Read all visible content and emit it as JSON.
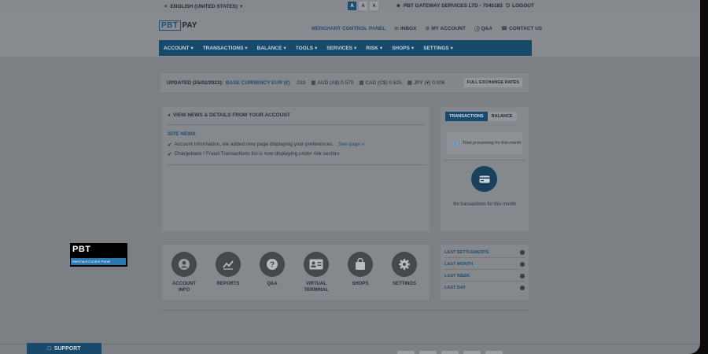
{
  "topbar": {
    "language": "ENGLISH (UNITED STATES)",
    "font_sizes": [
      "A",
      "A",
      "A"
    ],
    "company": "PBT GATEWAY SERVICES LTD - 7045183",
    "logout": "LOGOUT"
  },
  "logo": {
    "box_text": "PBT",
    "suffix": "PAY"
  },
  "header_links": {
    "merchant_panel": "MERCHANT CONTROL PANEL",
    "inbox": "INBOX",
    "my_account": "MY ACCOUNT",
    "qa": "Q&A",
    "contact": "CONTACT US"
  },
  "nav": [
    "ACCOUNT",
    "TRANSACTIONS",
    "BALANCE",
    "TOOLS",
    "SERVICES",
    "RISK",
    "SHOPS",
    "SETTINGS"
  ],
  "rates": {
    "updated": "UPDATED (25/02/2023):",
    "base": "BASE CURRENCY EUR (€)",
    "partial": ".033",
    "aud": "AUD (A$) 0.570",
    "cad": "CAD (C$) 0.625",
    "jpy": "JPY (¥) 0.006",
    "button": "FULL EXCHANGE RATES"
  },
  "news": {
    "heading": "VIEW NEWS & DETAILS FROM YOUR ACCOUNT",
    "section": "SITE NEWS",
    "item1": "Account Information, we added new page displaying your preferences.",
    "item1_link": "See page »",
    "item2": "Chargeback / Fraud Transactions list is now displaying under risk section."
  },
  "tx_panel": {
    "tab_transactions": "TRANSACTIONS",
    "tab_balance": "BALANCE",
    "info": "Total processing for this month",
    "empty": "No transactions for this month"
  },
  "shortcuts": [
    {
      "label1": "ACCOUNT",
      "label2": "INFO"
    },
    {
      "label1": "REPORTS",
      "label2": ""
    },
    {
      "label1": "Q&A",
      "label2": ""
    },
    {
      "label1": "VIRTUAL",
      "label2": "TERMINAL"
    },
    {
      "label1": "SHOPS",
      "label2": ""
    },
    {
      "label1": "SETTINGS",
      "label2": ""
    }
  ],
  "settlements": [
    "LAST SETTLEMENTS",
    "LAST MONTH",
    "LAST WEEK",
    "LAST DAY"
  ],
  "badge": {
    "title": "PBT",
    "subtitle": "Merchant Control Panel"
  },
  "support": "SUPPORT",
  "colors": {
    "nav": "#17496b",
    "accent": "#1e4d70"
  }
}
